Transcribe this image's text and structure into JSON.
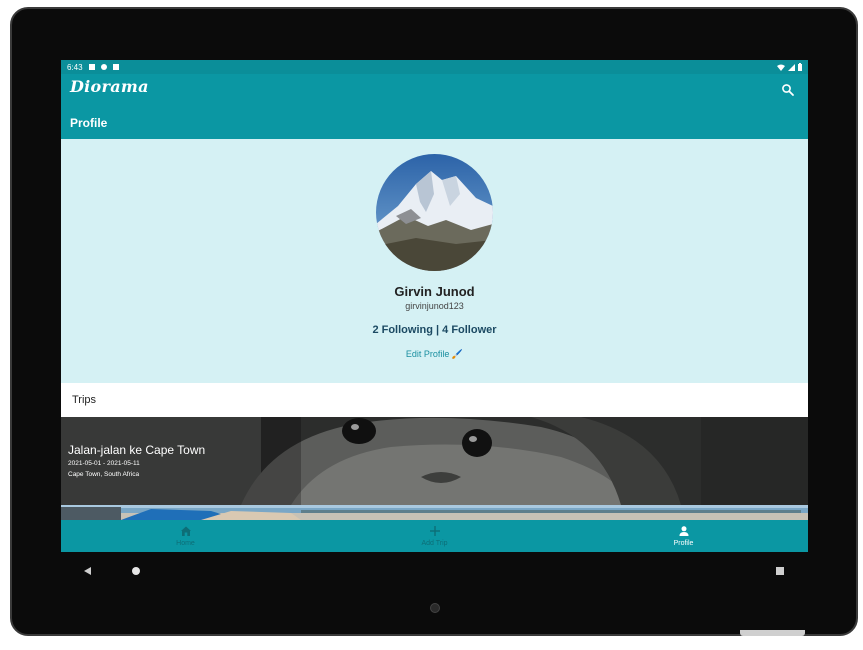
{
  "status_bar": {
    "time": "6:43"
  },
  "app_bar": {
    "brand": "Diorama",
    "page_title": "Profile"
  },
  "profile": {
    "name": "Girvin Junod",
    "username": "girvinjunod123",
    "following": "2 Following",
    "separator": " | ",
    "followers": "4 Follower",
    "edit_label": "Edit Profile 🖌️"
  },
  "trips": {
    "header": "Trips",
    "items": [
      {
        "title": "Jalan-jalan ke Cape Town",
        "dates": "2021-05-01 - 2021-05-11",
        "location": "Cape Town, South Africa"
      }
    ]
  },
  "bottom_nav": {
    "items": [
      {
        "label": "Home",
        "icon": "home-icon"
      },
      {
        "label": "Add Trip",
        "icon": "plus-icon"
      },
      {
        "label": "Profile",
        "icon": "person-icon",
        "active": true
      }
    ]
  },
  "colors": {
    "primary": "#0b97a3",
    "status": "#0b8e99",
    "profile_bg": "#d5f1f4",
    "accent_link": "#1a8fa0"
  }
}
